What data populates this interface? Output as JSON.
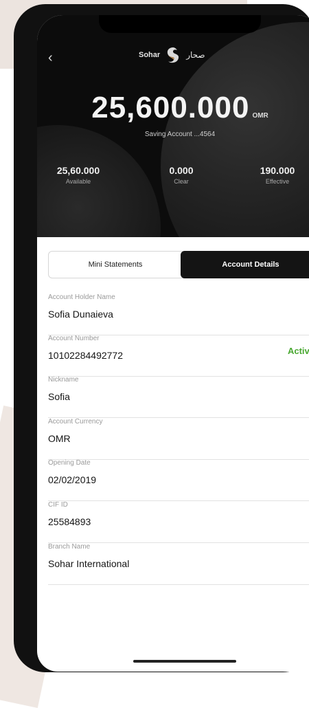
{
  "header": {
    "logo_en": "Sohar",
    "logo_ar": "صحار",
    "balance": "25,600.000",
    "currency": "OMR",
    "account_label": "Saving Account ...4564"
  },
  "stats": [
    {
      "value": "25,60.000",
      "label": "Available"
    },
    {
      "value": "0.000",
      "label": "Clear"
    },
    {
      "value": "190.000",
      "label": "Effective"
    }
  ],
  "tabs": {
    "mini": "Mini Statements",
    "details": "Account Details"
  },
  "fields": [
    {
      "label": "Account Holder Name",
      "value": "Sofia Dunaieva"
    },
    {
      "label": "Account Number",
      "value": "10102284492772",
      "status": "Active"
    },
    {
      "label": "Nickname",
      "value": "Sofia"
    },
    {
      "label": "Account Currency",
      "value": "OMR"
    },
    {
      "label": "Opening Date",
      "value": "02/02/2019"
    },
    {
      "label": "CIF ID",
      "value": "25584893"
    },
    {
      "label": "Branch Name",
      "value": "Sohar International"
    }
  ],
  "colors": {
    "header_bg": "#0c0c0c",
    "active_tab": "#141414",
    "status_active": "#4aa832"
  },
  "icons": {
    "back": "chevron-left-icon",
    "logo": "sohar-logo-icon"
  }
}
